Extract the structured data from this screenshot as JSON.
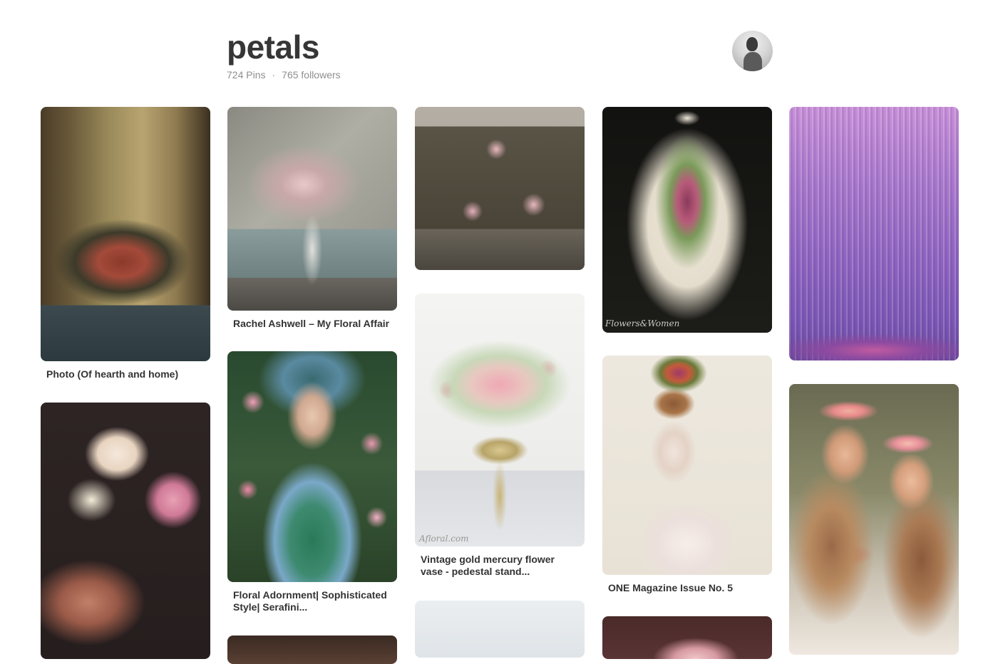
{
  "board": {
    "title": "petals",
    "pins_count": "724 Pins",
    "separator": "·",
    "followers": "765 followers"
  },
  "pins": [
    {
      "id": "hearth",
      "caption": "Photo (Of hearth and home)"
    },
    {
      "id": "peony-head",
      "caption": ""
    },
    {
      "id": "ashwell",
      "caption": "Rachel Ashwell – My Floral Affair"
    },
    {
      "id": "adornment",
      "caption": "Floral Adornment| Sophisticated Style| Serafini..."
    },
    {
      "id": "col2-bottom",
      "caption": ""
    },
    {
      "id": "boxes",
      "caption": ""
    },
    {
      "id": "mercury-vase",
      "caption": "Vintage gold mercury flower vase - pedestal stand...",
      "watermark": "Afloral.com"
    },
    {
      "id": "col3-bottom",
      "caption": ""
    },
    {
      "id": "mannequin",
      "caption": "",
      "watermark": "Flowers&Women"
    },
    {
      "id": "one-magazine",
      "caption": "ONE Magazine Issue No. 5"
    },
    {
      "id": "col4-bottom",
      "caption": ""
    },
    {
      "id": "wisteria",
      "caption": ""
    },
    {
      "id": "flower-crowns",
      "caption": ""
    }
  ]
}
